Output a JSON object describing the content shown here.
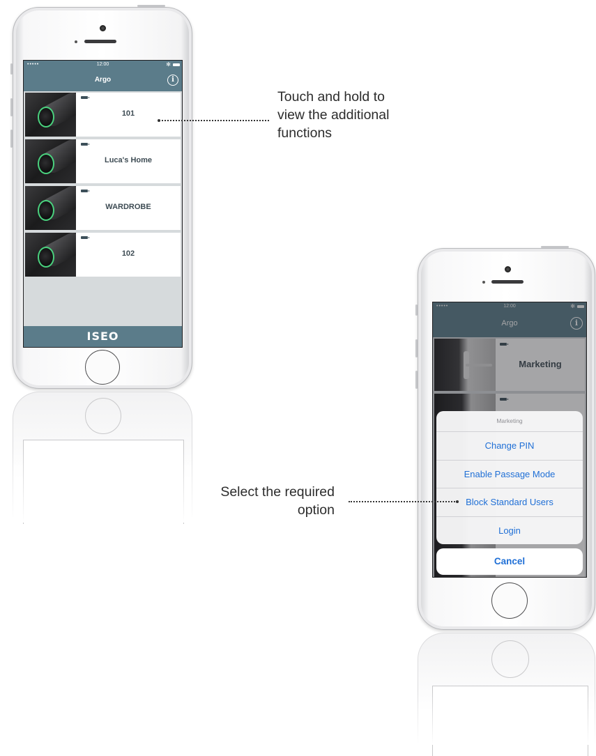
{
  "annotations": {
    "touch_hold": [
      "Touch and hold to",
      "view the additional",
      "functions"
    ],
    "select_option": [
      "Select the required",
      "option"
    ]
  },
  "phone_left": {
    "status": {
      "dots": "•••••",
      "time": "12:00",
      "bluetooth": "✻"
    },
    "nav_title": "Argo",
    "info_icon": "i",
    "locks": [
      {
        "name": "101"
      },
      {
        "name": "Luca's Home"
      },
      {
        "name": "WARDROBE"
      },
      {
        "name": "102"
      }
    ],
    "brand": "ISEO"
  },
  "phone_right": {
    "status": {
      "dots": "•••••",
      "time": "12:00",
      "bluetooth": "✻"
    },
    "nav_title": "Argo",
    "info_icon": "i",
    "locks": [
      {
        "name": "Marketing"
      }
    ],
    "action_sheet": {
      "title": "Marketing",
      "options": [
        "Change PIN",
        "Enable Passage Mode",
        "Block Standard Users",
        "Login"
      ],
      "cancel": "Cancel"
    }
  },
  "colors": {
    "nav_bar": "#5b7c8a",
    "action_text": "#1f6fd6",
    "lock_ring": "#4ad27e"
  }
}
